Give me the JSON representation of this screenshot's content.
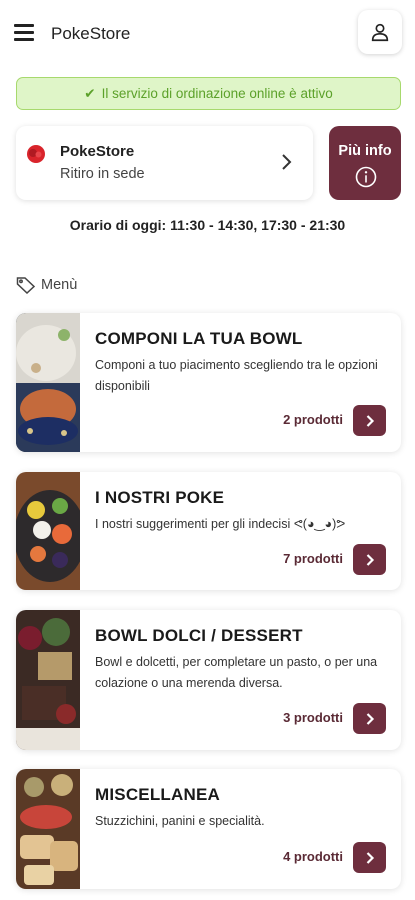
{
  "header": {
    "title": "PokeStore",
    "menu_icon": "hamburger-icon",
    "account_icon": "user-icon"
  },
  "status": {
    "text": "Il servizio di ordinazione online è attivo",
    "icon": "check-icon",
    "color": "#5ca12a"
  },
  "store": {
    "name": "PokeStore",
    "mode": "Ritiro in sede",
    "logo_color": "#d9242b"
  },
  "info_button": {
    "label": "Più info",
    "icon": "info-circle-icon"
  },
  "hours": {
    "text": "Orario di oggi: 11:30 - 14:30, 17:30 - 21:30"
  },
  "menu": {
    "heading": "Menù",
    "heading_icon": "tag-icon",
    "categories": [
      {
        "title": "COMPONI LA TUA BOWL",
        "description": "Componi a tuo piacimento scegliendo tra le opzioni disponibili",
        "count": "2 prodotti"
      },
      {
        "title": "I NOSTRI POKE",
        "description": "I nostri suggerimenti per gli indecisi ᕙ(◕‿◕)ᕗ",
        "count": "7 prodotti"
      },
      {
        "title": "BOWL DOLCI / DESSERT",
        "description": "Bowl e dolcetti, per completare un pasto, o per una colazione o una merenda diversa.",
        "count": "3 prodotti"
      },
      {
        "title": "MISCELLANEA",
        "description": "Stuzzichini, panini e specialità.",
        "count": "4 prodotti"
      }
    ]
  },
  "colors": {
    "accent": "#6e2e3e",
    "banner_bg": "#dff5c8",
    "banner_border": "#a7d96d"
  }
}
